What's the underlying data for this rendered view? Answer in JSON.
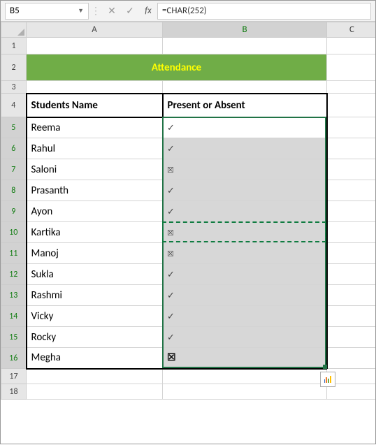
{
  "name_box": "B5",
  "formula": "=CHAR(252)",
  "columns": [
    "A",
    "B",
    "C"
  ],
  "rows": [
    "1",
    "2",
    "3",
    "4",
    "5",
    "6",
    "7",
    "8",
    "9",
    "10",
    "11",
    "12",
    "13",
    "14",
    "15",
    "16",
    "17",
    "18"
  ],
  "title": "Attendance",
  "headers": {
    "a": "Students Name",
    "b": "Present or Absent"
  },
  "students": [
    {
      "name": "Reema",
      "mark": "check"
    },
    {
      "name": "Rahul",
      "mark": "check"
    },
    {
      "name": "Saloni",
      "mark": "cross"
    },
    {
      "name": "Prasanth",
      "mark": "check"
    },
    {
      "name": "Ayon",
      "mark": "check"
    },
    {
      "name": "Kartika",
      "mark": "cross"
    },
    {
      "name": "Manoj",
      "mark": "cross"
    },
    {
      "name": "Sukla",
      "mark": "check"
    },
    {
      "name": "Rashmi",
      "mark": "check"
    },
    {
      "name": "Vicky",
      "mark": "check"
    },
    {
      "name": "Rocky",
      "mark": "check"
    },
    {
      "name": "Megha",
      "mark": "cross_strong"
    }
  ],
  "symbols": {
    "check": "✓",
    "cross": "☒",
    "cross_strong": "☒"
  },
  "colors": {
    "title_bg": "#70ad47",
    "title_fg": "#ffff00",
    "sel_border": "#217346"
  }
}
